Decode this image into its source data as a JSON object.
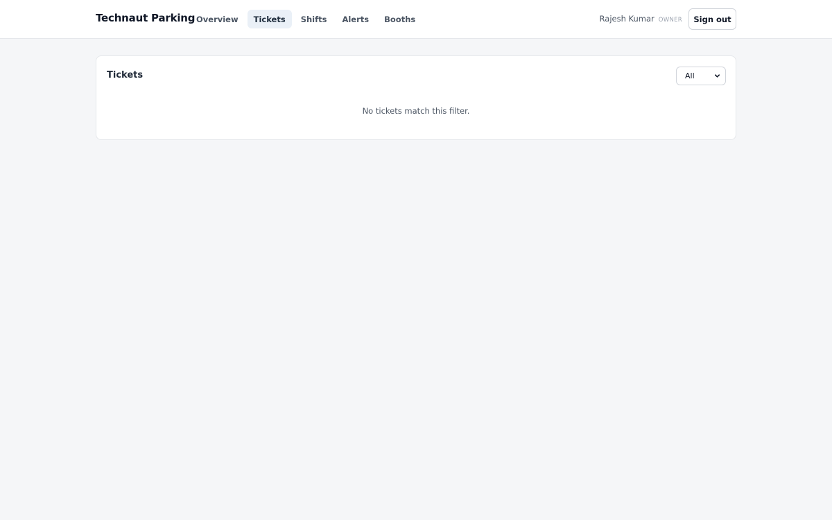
{
  "app": {
    "brand": "Technaut Parking"
  },
  "nav": {
    "items": [
      {
        "label": "Overview",
        "active": false
      },
      {
        "label": "Tickets",
        "active": true
      },
      {
        "label": "Shifts",
        "active": false
      },
      {
        "label": "Alerts",
        "active": false
      },
      {
        "label": "Booths",
        "active": false
      }
    ]
  },
  "user": {
    "name": "Rajesh Kumar",
    "role": "OWNER",
    "signout_label": "Sign out"
  },
  "tickets": {
    "title": "Tickets",
    "filter": {
      "selected": "All"
    },
    "empty_message": "No tickets match this filter."
  },
  "colors": {
    "background": "#f5f6f8",
    "active_nav_bg": "#eaf0f7",
    "text_primary": "#111827",
    "text_muted": "#4b5563"
  },
  "icons": {
    "filter_caret": "chevron-down-icon"
  }
}
